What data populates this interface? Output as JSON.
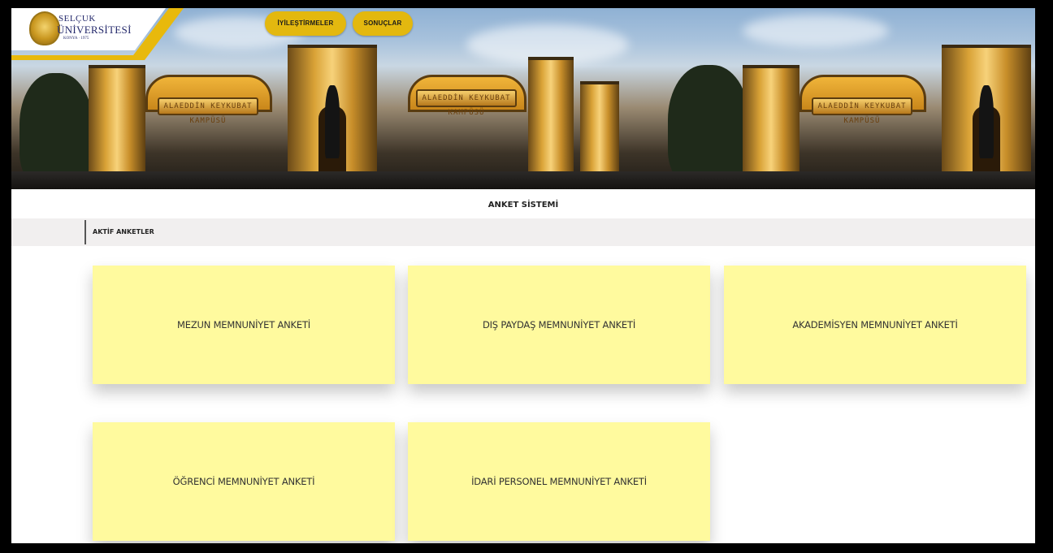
{
  "logo": {
    "line1": "SELÇUK",
    "line2": "ÜNİVERSİTESİ",
    "line3": "KONYA · 1975"
  },
  "nav": {
    "items": [
      {
        "label": "İYİLEŞTİRMELER"
      },
      {
        "label": "SONUÇLAR"
      }
    ]
  },
  "banner": {
    "gate_sign": "ALAEDDİN KEYKUBAT KAMPÜSÜ"
  },
  "page": {
    "title": "ANKET SİSTEMİ",
    "section_label": "AKTİF ANKETLER"
  },
  "surveys": [
    {
      "label": "MEZUN MEMNUNİYET ANKETİ"
    },
    {
      "label": "DIŞ PAYDAŞ MEMNUNİYET ANKETİ"
    },
    {
      "label": "AKADEMİSYEN MEMNUNİYET ANKETİ"
    },
    {
      "label": "ÖĞRENCİ MEMNUNİYET ANKETİ"
    },
    {
      "label": "İDARİ PERSONEL MEMNUNİYET ANKETİ"
    }
  ],
  "colors": {
    "accent": "#e3b80f",
    "card_bg": "#fffa9e",
    "section_bg": "#f1efef",
    "frame": "#000000"
  }
}
